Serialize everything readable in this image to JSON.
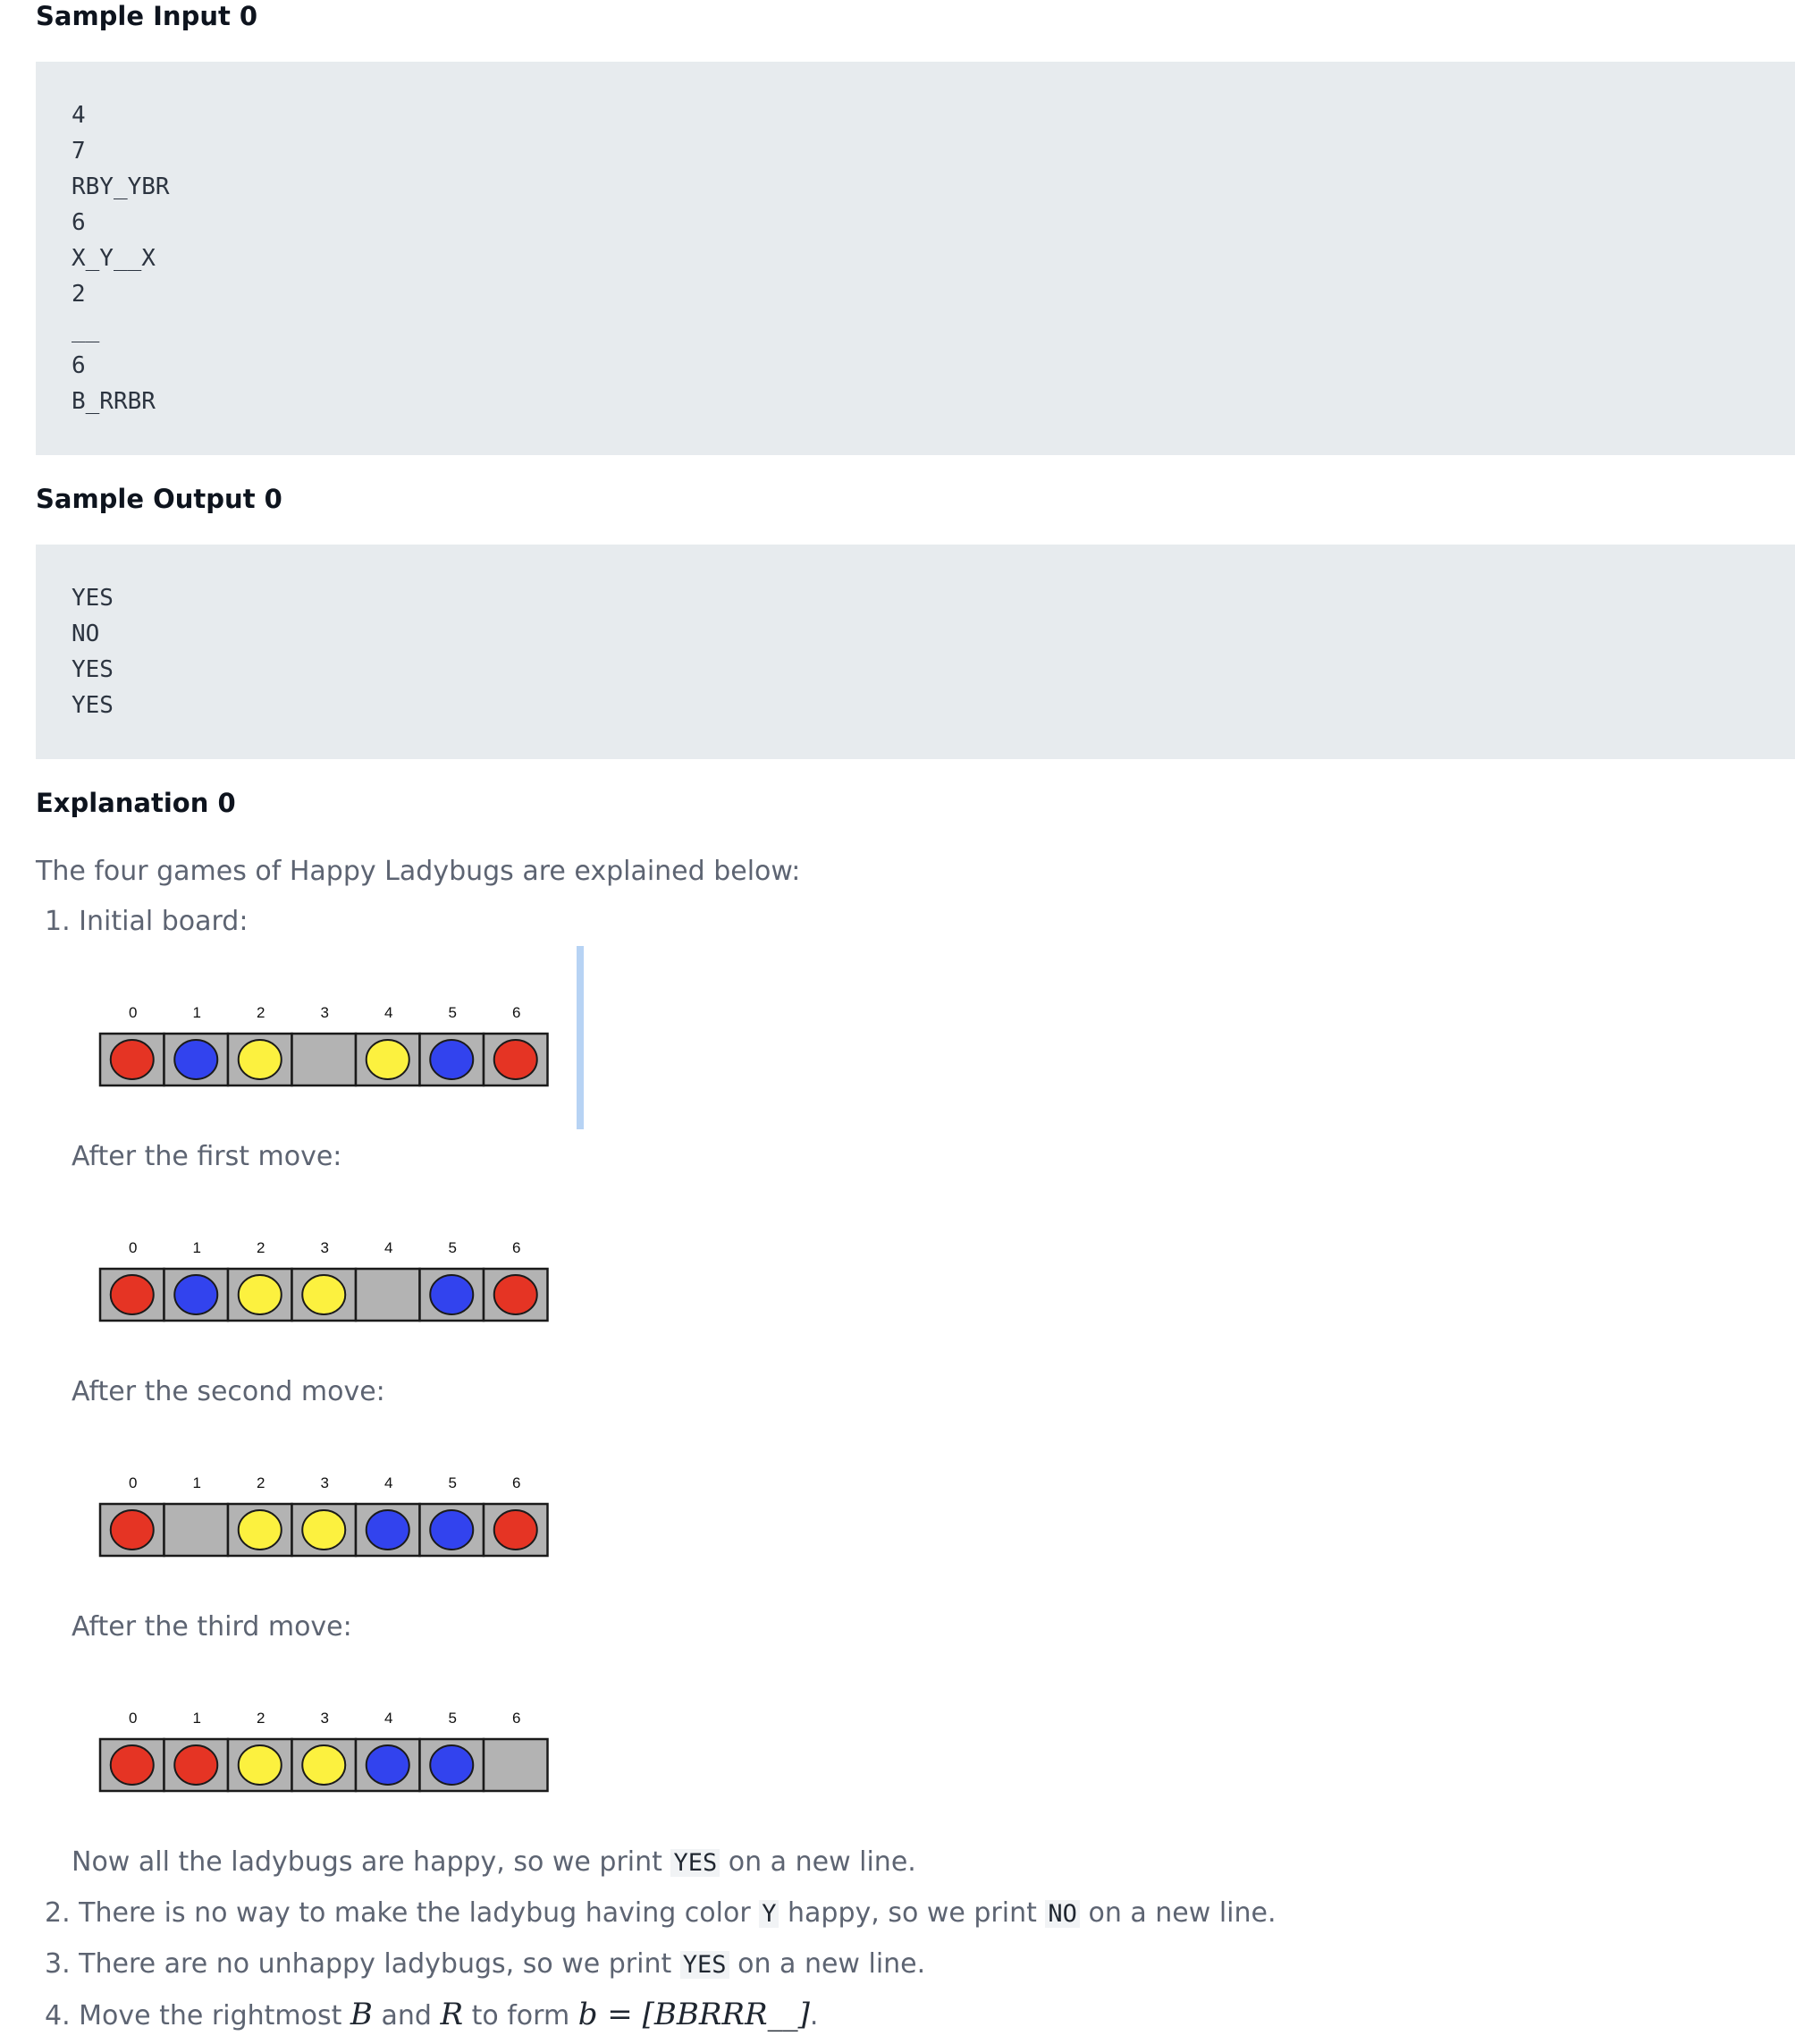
{
  "sample_input": {
    "heading": "Sample Input 0",
    "lines": [
      "4",
      "7",
      "RBY_YBR",
      "6",
      "X_Y__X",
      "2",
      "__",
      "6",
      "B_RRBR"
    ]
  },
  "sample_output": {
    "heading": "Sample Output 0",
    "lines": [
      "YES",
      "NO",
      "YES",
      "YES"
    ]
  },
  "explanation": {
    "heading": "Explanation 0",
    "intro": "The four games of Happy Ladybugs are explained below:",
    "item1": {
      "num": "1.",
      "text": "Initial board:"
    },
    "captions": [
      "After the first move:",
      "After the second move:",
      "After the third move:"
    ],
    "conclusion": {
      "before": "Now all the ladybugs are happy, so we print ",
      "code": "YES",
      "after": " on a new line."
    },
    "item2": {
      "num": "2.",
      "before": "There is no way to make the ladybug having color ",
      "code1": "Y",
      "middle": " happy, so we print ",
      "code2": "NO",
      "after": " on a new line."
    },
    "item3": {
      "num": "3.",
      "before": "There are no unhappy ladybugs, so we print ",
      "code": "YES",
      "after": " on a new line."
    },
    "item4": {
      "num": "4.",
      "before": "Move the rightmost ",
      "m1": "B",
      "and": " and ",
      "m2": "R",
      "to": " to form ",
      "m3": "b",
      "eq": " = [",
      "m4": "BBRRR__",
      "close": "]",
      "end": "."
    }
  },
  "boards": [
    {
      "indices": [
        "0",
        "1",
        "2",
        "3",
        "4",
        "5",
        "6"
      ],
      "cells": [
        "R",
        "B",
        "Y",
        "_",
        "Y",
        "B",
        "R"
      ]
    },
    {
      "indices": [
        "0",
        "1",
        "2",
        "3",
        "4",
        "5",
        "6"
      ],
      "cells": [
        "R",
        "B",
        "Y",
        "Y",
        "_",
        "B",
        "R"
      ]
    },
    {
      "indices": [
        "0",
        "1",
        "2",
        "3",
        "4",
        "5",
        "6"
      ],
      "cells": [
        "R",
        "_",
        "Y",
        "Y",
        "B",
        "B",
        "R"
      ]
    },
    {
      "indices": [
        "0",
        "1",
        "2",
        "3",
        "4",
        "5",
        "6"
      ],
      "cells": [
        "R",
        "R",
        "Y",
        "Y",
        "B",
        "B",
        "_"
      ]
    }
  ],
  "colors": {
    "R": "#e53424",
    "B": "#3243ee",
    "Y": "#fcf13f",
    "cell": "#b3b3b3",
    "border": "#1a1a1a",
    "code_bg": "#e7ebee"
  }
}
